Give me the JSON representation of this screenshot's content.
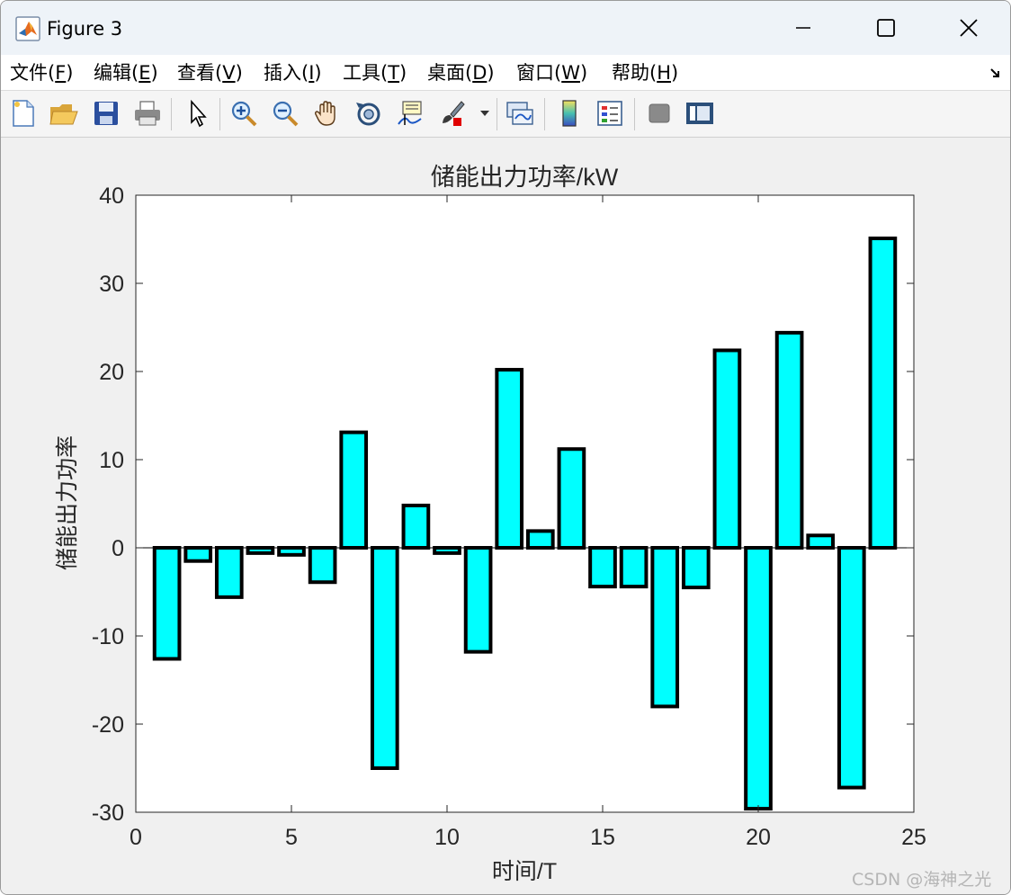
{
  "window": {
    "title": "Figure 3"
  },
  "menu": {
    "items": [
      {
        "prefix": "文件(",
        "key": "F",
        "suffix": ")"
      },
      {
        "prefix": "编辑(",
        "key": "E",
        "suffix": ")"
      },
      {
        "prefix": "查看(",
        "key": "V",
        "suffix": ")"
      },
      {
        "prefix": "插入(",
        "key": "I",
        "suffix": ")"
      },
      {
        "prefix": "工具(",
        "key": "T",
        "suffix": ")"
      },
      {
        "prefix": "桌面(",
        "key": "D",
        "suffix": ")"
      },
      {
        "prefix": "窗口(",
        "key": "W",
        "suffix": ")"
      },
      {
        "prefix": "帮助(",
        "key": "H",
        "suffix": ")"
      }
    ]
  },
  "toolbar": {
    "icons": [
      "new-figure-icon",
      "open-file-icon",
      "save-icon",
      "print-icon",
      "select-arrow-icon",
      "zoom-in-icon",
      "zoom-out-icon",
      "pan-hand-icon",
      "rotate-3d-icon",
      "data-cursor-icon",
      "brush-icon",
      "link-plot-icon",
      "colorbar-icon",
      "legend-icon",
      "hide-plot-tools-icon",
      "show-plot-tools-icon"
    ]
  },
  "colors": {
    "bar_fill": "#00ffff",
    "bar_edge": "#000000",
    "axes_bg": "#ffffff",
    "figure_bg": "#f0f0f0"
  },
  "chart_data": {
    "type": "bar",
    "title": "储能出力功率/kW",
    "xlabel": "时间/T",
    "ylabel": "储能出力功率",
    "xlim": [
      0,
      25
    ],
    "ylim": [
      -30,
      40
    ],
    "xticks": [
      0,
      5,
      10,
      15,
      20,
      25
    ],
    "yticks": [
      -30,
      -20,
      -10,
      0,
      10,
      20,
      30,
      40
    ],
    "x": [
      1,
      2,
      3,
      4,
      5,
      6,
      7,
      8,
      9,
      10,
      11,
      12,
      13,
      14,
      15,
      16,
      17,
      18,
      19,
      20,
      21,
      22,
      23,
      24
    ],
    "values": [
      -12.6,
      -1.5,
      -5.6,
      -0.6,
      -0.8,
      -3.9,
      13.1,
      -25.0,
      4.8,
      -0.6,
      -11.8,
      20.2,
      1.9,
      11.2,
      -4.4,
      -4.4,
      -18.0,
      -4.5,
      22.4,
      -29.6,
      24.4,
      1.4,
      -27.2,
      35.1
    ],
    "grid": false
  },
  "watermark": "CSDN @海神之光"
}
